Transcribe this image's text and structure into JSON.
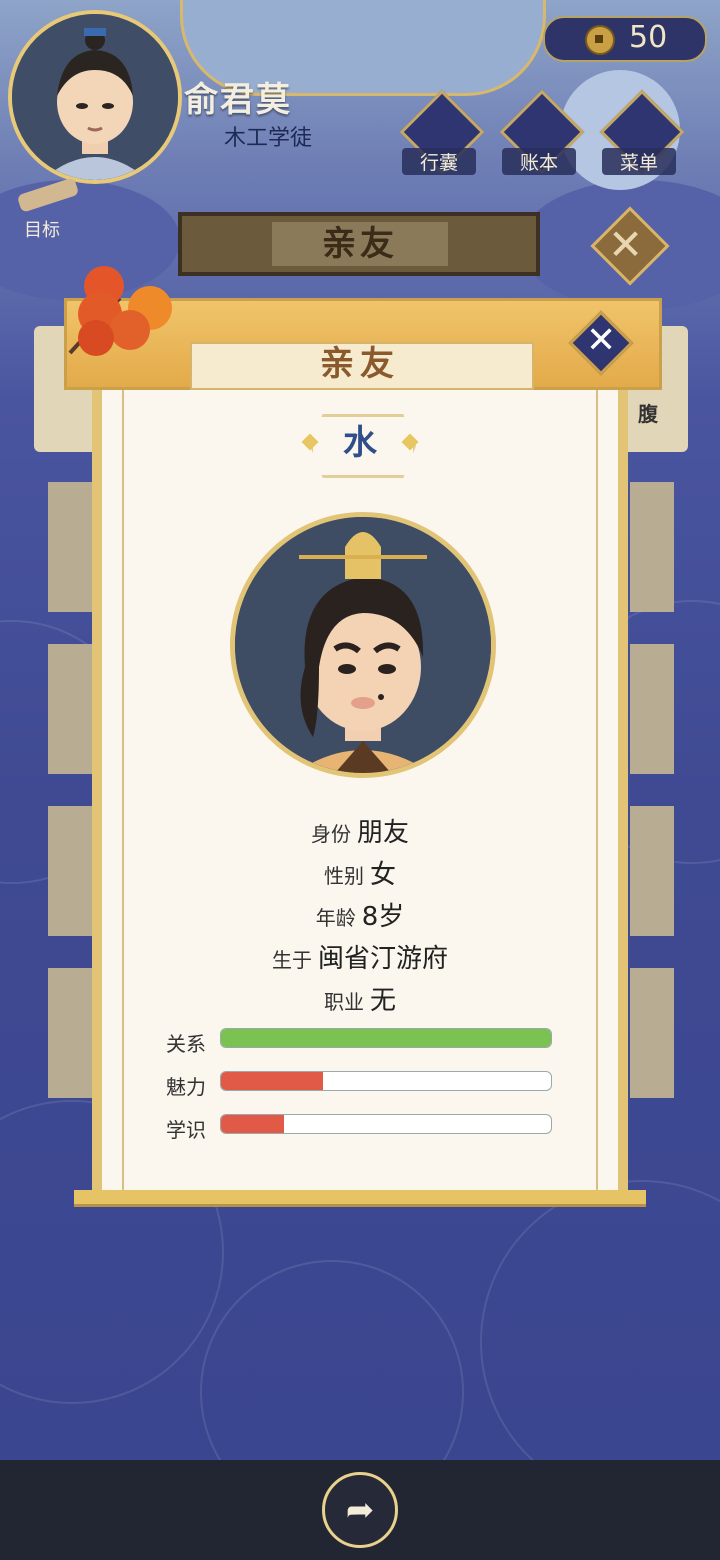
{
  "header": {
    "player_name": "俞君莫",
    "player_title": "木工学徒",
    "coins": "50",
    "goal_label": "目标",
    "menu": [
      {
        "label": "行囊",
        "icon": "bag-icon"
      },
      {
        "label": "账本",
        "icon": "ledger-icon"
      },
      {
        "label": "菜单",
        "icon": "menu-dots-icon"
      }
    ]
  },
  "section": {
    "title": "亲友"
  },
  "modal": {
    "title": "亲友",
    "name": "水",
    "info": [
      {
        "key": "身份",
        "value": "朋友"
      },
      {
        "key": "性别",
        "value": "女"
      },
      {
        "key": "年龄",
        "value": "8岁"
      },
      {
        "key": "生于",
        "value": "闽省汀游府"
      },
      {
        "key": "职业",
        "value": "无"
      }
    ],
    "stats": [
      {
        "label": "关系",
        "fraction": 1.0,
        "color": "#7cc252"
      },
      {
        "label": "魅力",
        "fraction": 0.31,
        "color": "#e05a47"
      },
      {
        "label": "学识",
        "fraction": 0.19,
        "color": "#e05a47"
      }
    ]
  },
  "background_side_card_text": "腹"
}
